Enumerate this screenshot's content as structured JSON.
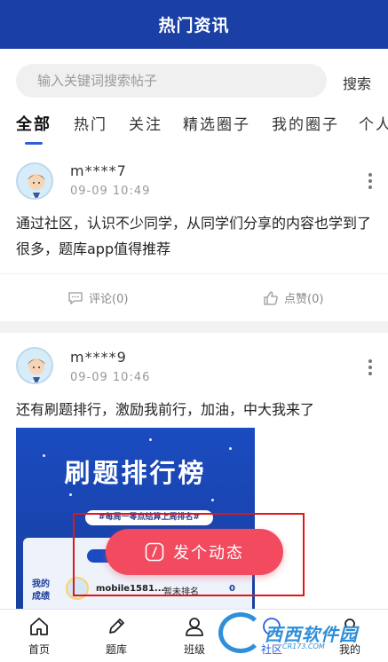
{
  "header": {
    "title": "热门资讯"
  },
  "search": {
    "placeholder": "输入关键词搜索帖子",
    "button_label": "搜索"
  },
  "tabs": [
    {
      "label": "全部",
      "active": true
    },
    {
      "label": "热门",
      "active": false
    },
    {
      "label": "关注",
      "active": false
    },
    {
      "label": "精选圈子",
      "active": false
    },
    {
      "label": "我的圈子",
      "active": false
    },
    {
      "label": "个人",
      "active": false
    }
  ],
  "posts": [
    {
      "username": "m****7",
      "time": "09-09 10:49",
      "text": "通过社区，认识不少同学，从同学们分享的内容也学到了很多，题库app值得推荐",
      "comment_label": "评论(0)",
      "like_label": "点赞(0)"
    },
    {
      "username": "m****9",
      "time": "09-09 10:46",
      "text": "还有刷题排行，激励我前行，加油，中大我来了",
      "image": {
        "title": "刷题排行榜",
        "subtitle": "#每周一零点结算上周排名#",
        "pill": "本",
        "card_label": "我的成绩",
        "name": "mobile1581...",
        "rank": "暂未排名",
        "score": "0"
      }
    }
  ],
  "fab": {
    "label": "发个动态"
  },
  "bottom_nav": [
    {
      "label": "首页",
      "icon": "home-icon"
    },
    {
      "label": "题库",
      "icon": "pencil-icon"
    },
    {
      "label": "班级",
      "icon": "user-icon"
    },
    {
      "label": "社区",
      "icon": "community-icon",
      "active": true
    },
    {
      "label": "我的",
      "icon": "profile-icon"
    }
  ],
  "watermark": {
    "text": "西西软件园",
    "sub": "CR173.COM"
  },
  "colors": {
    "header_bg": "#1a3fa5",
    "accent": "#2c5ed8",
    "fab_bg": "#f24a5e",
    "highlight": "#e0161b"
  }
}
